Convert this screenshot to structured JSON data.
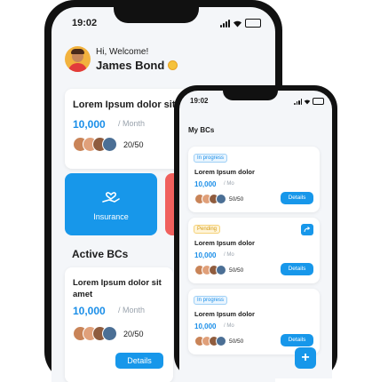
{
  "back": {
    "time": "19:02",
    "greeting": "Hi, Welcome!",
    "user_name": "James Bond",
    "featured": {
      "title": "Lorem Ipsum dolor sit",
      "amount": "10,000",
      "period": "/ Month",
      "members": "20/50"
    },
    "tiles": [
      {
        "label": "Insurance"
      }
    ],
    "section_title": "Active BCs",
    "active_card": {
      "title": "Lorem Ipsum dolor sit amet",
      "amount": "10,000",
      "period": "/ Month",
      "members": "20/50",
      "button": "Details"
    }
  },
  "front": {
    "time": "19:02",
    "title": "My BCs",
    "cards": [
      {
        "status": "In progress",
        "status_type": "progress",
        "title": "Lorem Ipsum dolor",
        "amount": "10,000",
        "period": "/ Mo",
        "members": "50/50",
        "button": "Details"
      },
      {
        "status": "Pending",
        "status_type": "pending",
        "title": "Lorem Ipsum dolor",
        "amount": "10,000",
        "period": "/ Mo",
        "members": "50/50",
        "button": "Details"
      },
      {
        "status": "In progress",
        "status_type": "progress",
        "title": "Lorem Ipsum dolor",
        "amount": "10,000",
        "period": "/ Mo",
        "members": "50/50",
        "button": "Details"
      }
    ],
    "fab": "+"
  },
  "colors": {
    "accent": "#1797ea",
    "tile_blue": "#1797ea",
    "tile_red": "#f0605d",
    "pending_bg": "#fff4d8"
  }
}
